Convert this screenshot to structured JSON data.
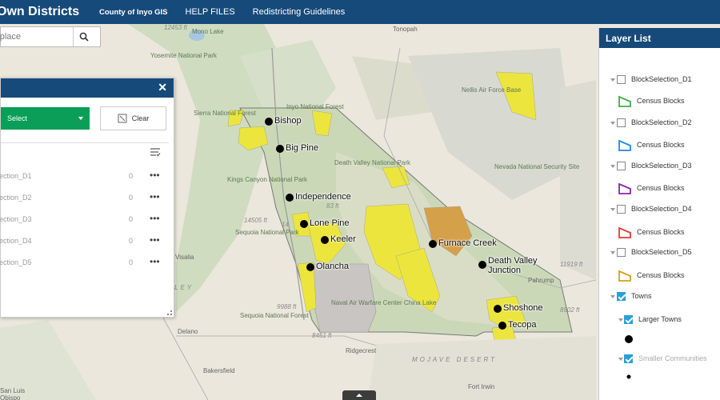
{
  "header": {
    "title": "Own Districts",
    "links": [
      "County of Inyo GIS",
      "HELP FILES",
      "Redistricting Guidelines"
    ]
  },
  "search": {
    "placeholder": "r place"
  },
  "select_panel": {
    "select_label": "Select",
    "clear_label": "Clear",
    "rows": [
      {
        "name": "ection_D1",
        "count": "0"
      },
      {
        "name": "ection_D2",
        "count": "0"
      },
      {
        "name": "ection_D3",
        "count": "0"
      },
      {
        "name": "ection_D4",
        "count": "0"
      },
      {
        "name": "ection_D5",
        "count": "0"
      }
    ],
    "more_glyph": "•••"
  },
  "layer_list": {
    "title": "Layer List",
    "sublabel": "Census Blocks",
    "layers": [
      {
        "name": "BlockSelection_D1",
        "color": "#3cb043"
      },
      {
        "name": "BlockSelection_D2",
        "color": "#1e88e5"
      },
      {
        "name": "BlockSelection_D3",
        "color": "#8e24aa"
      },
      {
        "name": "BlockSelection_D4",
        "color": "#e53935"
      },
      {
        "name": "BlockSelection_D5",
        "color": "#d4a017"
      }
    ],
    "towns": "Towns",
    "larger": "Larger Towns",
    "smaller": "Smaller Communities"
  },
  "map": {
    "towns": [
      "Bishop",
      "Big Pine",
      "Independence",
      "Lone Pine",
      "Keeler",
      "Olancha",
      "Furnace Creek",
      "Death Valley Junction",
      "Shoshone",
      "Tecopa"
    ],
    "labels": {
      "tonopah": "Tonopah",
      "nellis": "Nellis Air Force Base",
      "nevada": "Nevada National Security Site",
      "pahrump": "Pahrump",
      "ridgecrest": "Ridgecrest",
      "delano": "Delano",
      "bakersfield": "Bakersfield",
      "fortirwin": "Fort Irwin",
      "visalia": "Visalia",
      "sanluis": "San Luis Obispo",
      "mojave": "MOJAVE DESERT",
      "valley": "LEY",
      "navalair": "Naval Air Warfare Center China Lake",
      "monolake": "Mono Lake",
      "sequoia": "Sequoia National Park",
      "kings": "Kings Canyon National Park",
      "sierra": "Sierra National Forest",
      "inyo": "Inyo National Forest",
      "deathvalley": "Death Valley National Park",
      "sequoiaforest": "Sequoia National Forest",
      "yosemite": "Yosemite National Park",
      "e1": "12453 ft",
      "e2": "14505 ft",
      "e3": "11919 ft",
      "e4": "9988 ft",
      "e5": "8451 ft",
      "e6": "8502 ft",
      "e7": "83 ft",
      "e8": "14"
    }
  }
}
